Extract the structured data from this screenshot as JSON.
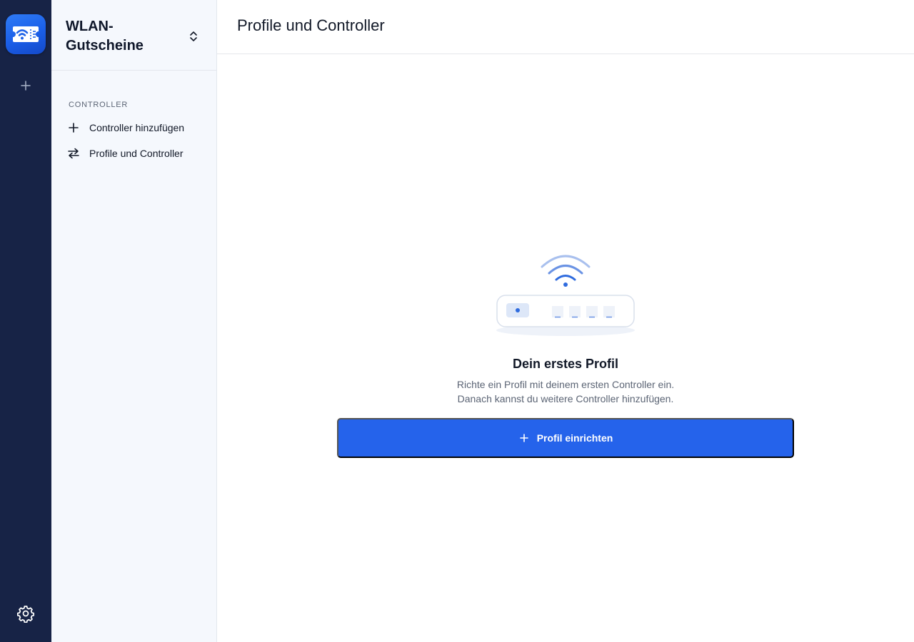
{
  "app": {
    "name": "WLAN-Gutscheine"
  },
  "rail": {
    "app_icon": "wifi-voucher-icon",
    "add_icon": "plus-icon",
    "settings_icon": "gear-icon"
  },
  "sidebar": {
    "title": "WLAN-Gutscheine",
    "switch_icon": "chevron-up-down-icon",
    "section_label": "CONTROLLER",
    "items": [
      {
        "label": "Controller hinzufügen",
        "icon": "plus-icon"
      },
      {
        "label": "Profile und Controller",
        "icon": "swap-arrows-icon"
      }
    ]
  },
  "main": {
    "title": "Profile und Controller",
    "empty_state": {
      "illustration": "router-wifi-icon",
      "heading": "Dein erstes Profil",
      "description_line1": "Richte ein Profil mit deinem ersten Controller ein.",
      "description_line2": "Danach kannst du weitere Controller hinzufügen.",
      "button_label": "Profil einrichten",
      "button_icon": "plus-icon"
    }
  },
  "colors": {
    "rail_bg": "#172346",
    "sidebar_bg": "#f5f8fd",
    "accent": "#2563eb",
    "text_muted": "#5b6474"
  }
}
